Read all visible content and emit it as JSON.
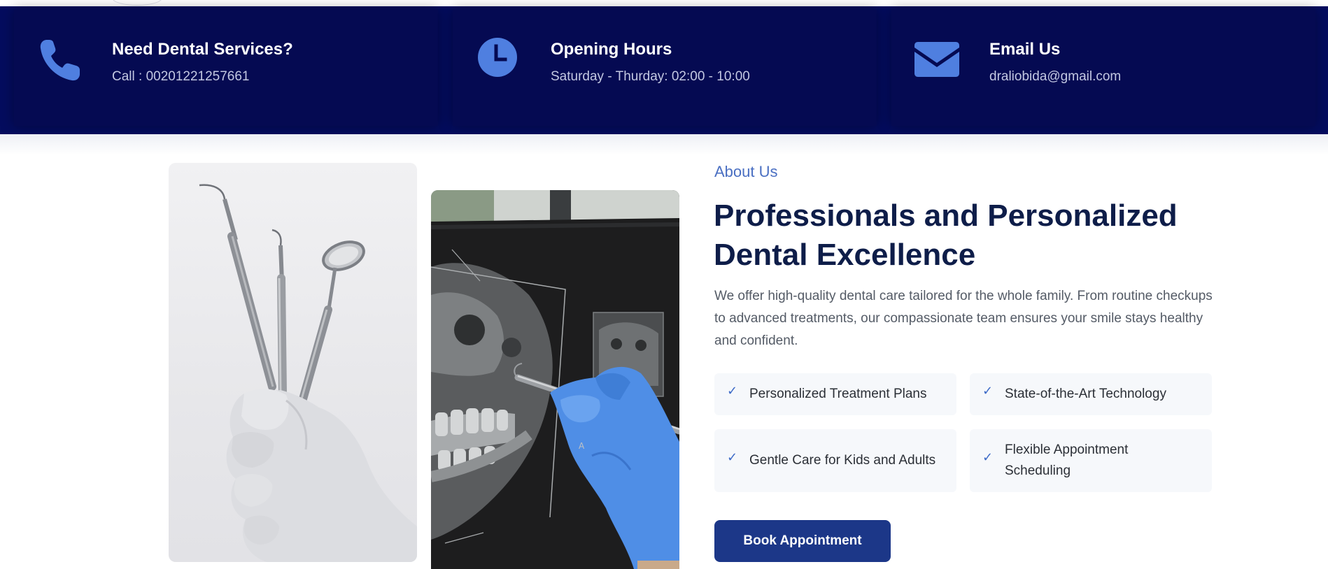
{
  "info_bar": {
    "cards": [
      {
        "icon": "phone-icon",
        "title": "Need Dental Services?",
        "subtitle": "Call : 00201221257661"
      },
      {
        "icon": "clock-icon",
        "title": "Opening Hours",
        "subtitle": "Saturday - Thurday: 02:00 - 10:00"
      },
      {
        "icon": "envelope-icon",
        "title": "Email Us",
        "subtitle": "draliobida@gmail.com"
      }
    ]
  },
  "about": {
    "label": "About Us",
    "headline_line1": "Professionals and Personalized",
    "headline_line2": "Dental Excellence",
    "description": "We offer high-quality dental care tailored for the whole family. From routine checkups to advanced treatments, our compassionate team ensures your smile stays healthy and confident.",
    "features": [
      {
        "icon": "check-icon",
        "label": "Personalized Treatment Plans"
      },
      {
        "icon": "check-icon",
        "label": "State-of-the-Art Technology"
      },
      {
        "icon": "check-icon",
        "label": "Gentle Care for Kids and Adults"
      },
      {
        "icon": "check-icon",
        "label_line1": "Flexible Appointment",
        "label_line2": "Scheduling"
      }
    ],
    "cta_label": "Book Appointment"
  },
  "colors": {
    "info_bar_bg": "#040c5e",
    "icon_accent": "#4f7fe0",
    "headline": "#0e1d49",
    "about_label": "#4a6fc2",
    "button_bg": "#1c3788"
  }
}
